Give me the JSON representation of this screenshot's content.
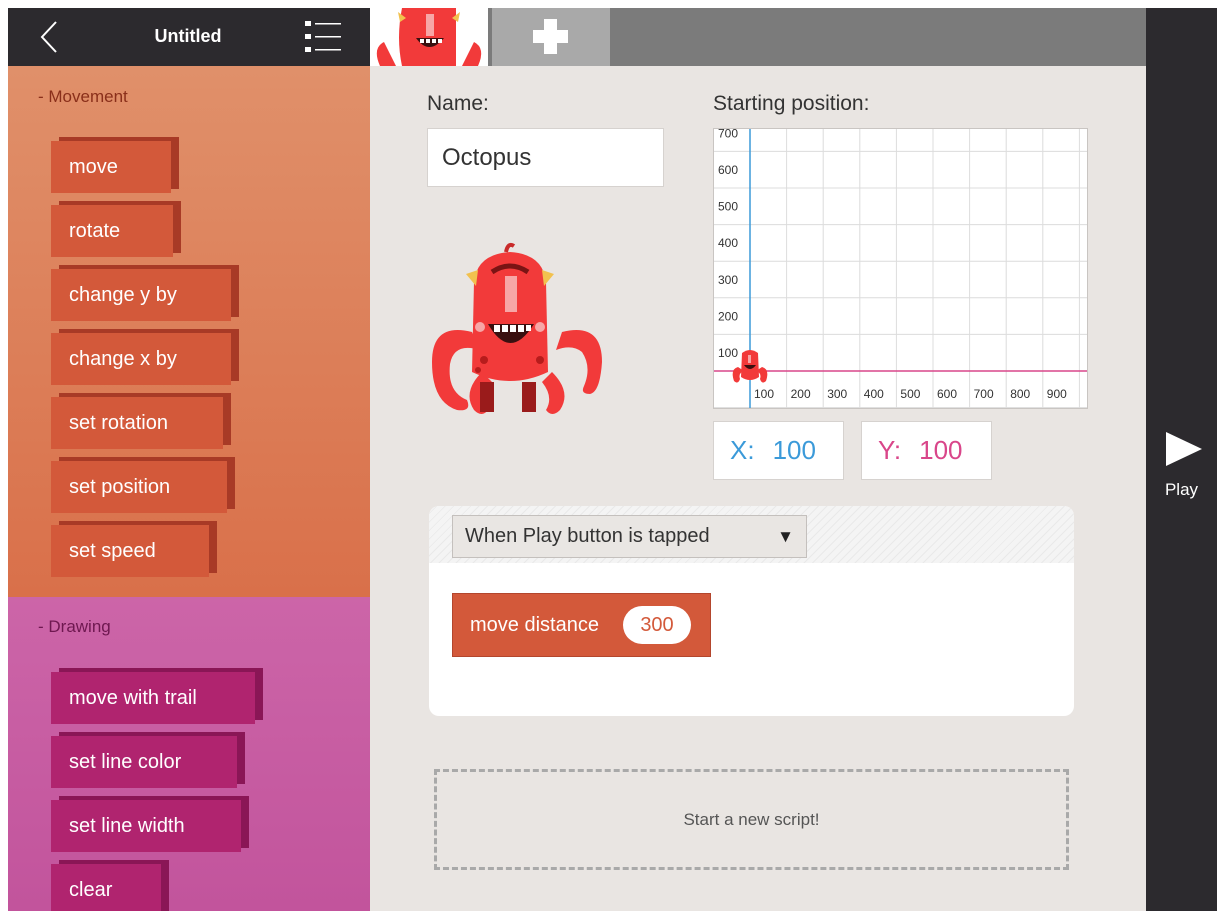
{
  "header": {
    "title": "Untitled"
  },
  "sidebar": {
    "movement": {
      "title": "- Movement",
      "blocks": [
        "move",
        "rotate",
        "change y by",
        "change x by",
        "set rotation",
        "set position",
        "set speed"
      ]
    },
    "drawing": {
      "title": "- Drawing",
      "blocks": [
        "move with trail",
        "set line color",
        "set line width",
        "clear"
      ]
    }
  },
  "editor": {
    "name_label": "Name:",
    "name_value": "Octopus",
    "start_label": "Starting position:",
    "grid": {
      "y_ticks": [
        "700",
        "600",
        "500",
        "400",
        "300",
        "200",
        "100"
      ],
      "x_ticks": [
        "100",
        "200",
        "300",
        "400",
        "500",
        "600",
        "700",
        "800",
        "900"
      ]
    },
    "x_label": "X:",
    "x_value": "100",
    "y_label": "Y:",
    "y_value": "100"
  },
  "script": {
    "trigger": "When Play button is tapped",
    "trigger_arrow": "▼",
    "block_label": "move distance",
    "block_value": "300",
    "new_script": "Start a new script!"
  },
  "play": {
    "label": "Play"
  },
  "colors": {
    "x_axis": "#d9468a",
    "y_axis": "#3b9ad9",
    "sprite_red": "#f23a3a"
  },
  "icons": {
    "back": "chevron-left-icon",
    "menu": "list-menu-icon",
    "add": "plus-icon",
    "play": "play-triangle-icon"
  }
}
